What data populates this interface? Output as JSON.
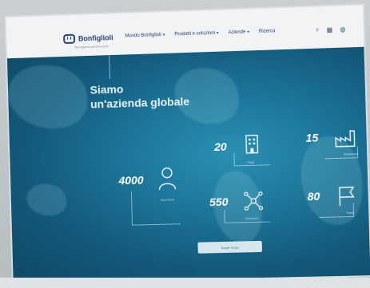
{
  "brand": {
    "name": "Bonfiglioli",
    "tagline": "the highest performance"
  },
  "nav": {
    "items": [
      {
        "label": "Mondo Bonfiglioli",
        "has_dropdown": true
      },
      {
        "label": "Prodotti e soluzioni",
        "has_dropdown": true
      },
      {
        "label": "Aziende",
        "has_dropdown": true
      },
      {
        "label": "Ricerca",
        "has_dropdown": false
      }
    ],
    "icons": [
      "search-icon",
      "grid-icon",
      "globe-icon"
    ]
  },
  "hero": {
    "headline_line1": "Siamo",
    "headline_line2": "un'azienda globale",
    "cta_label": "Scopri di più"
  },
  "stats": [
    {
      "value": "20",
      "caption": "Filiali",
      "icon": "building-icon"
    },
    {
      "value": "15",
      "caption": "Stabilimenti",
      "icon": "factory-icon"
    },
    {
      "value": "4000",
      "caption": "Dipendenti",
      "icon": "person-icon"
    },
    {
      "value": "550",
      "caption": "Distributori",
      "icon": "network-icon"
    },
    {
      "value": "80",
      "caption": "Paesi",
      "icon": "flag-icon"
    }
  ],
  "colors": {
    "brand": "#2b3f73",
    "hero": "#1c7498",
    "navbar": "#f1f3f4"
  }
}
